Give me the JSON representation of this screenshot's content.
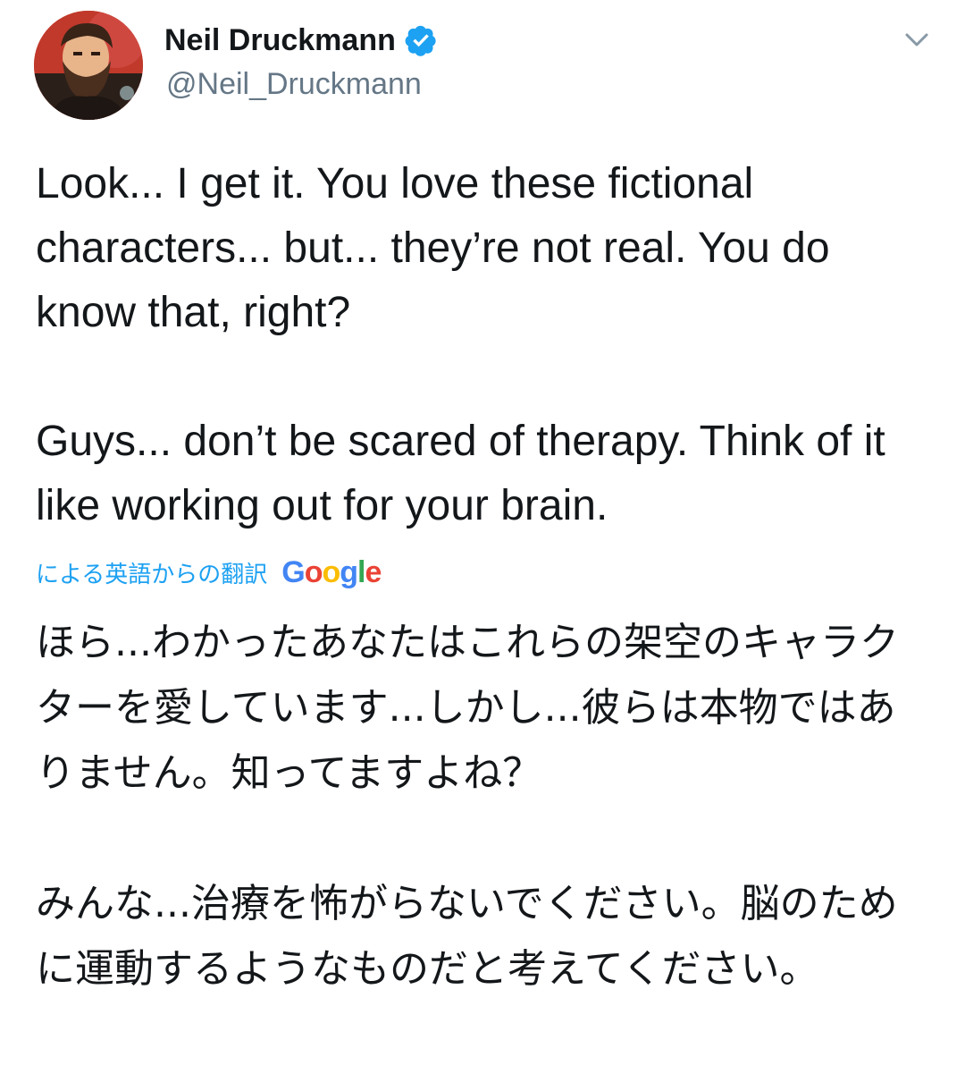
{
  "author": {
    "display_name": "Neil Druckmann",
    "handle": "@Neil_Druckmann",
    "verified": true,
    "avatar_icon": "bearded-man-portrait-avatar"
  },
  "tweet": {
    "paragraphs": [
      "Look... I get it. You love these fictional characters... but... they’re not real. You do know that, right?",
      "Guys... don’t be scared of therapy. Think of it like working out for your brain."
    ]
  },
  "translation": {
    "label": "による英語からの翻訳",
    "provider": "Google",
    "paragraphs": [
      "ほら...わかったあなたはこれらの架空のキャラクターを愛しています...しかし...彼らは本物ではありません。知ってますよね？",
      "みんな...治療を怖がらないでください。脳のために運動するようなものだと考えてください。"
    ]
  },
  "icons": {
    "verified": "verified-badge-icon",
    "menu": "chevron-down-icon"
  },
  "colors": {
    "text": "#14171a",
    "secondary": "#657786",
    "accent": "#1da1f2",
    "google_blue": "#4285F4",
    "google_red": "#EA4335",
    "google_yellow": "#FBBC05",
    "google_green": "#34A853"
  }
}
